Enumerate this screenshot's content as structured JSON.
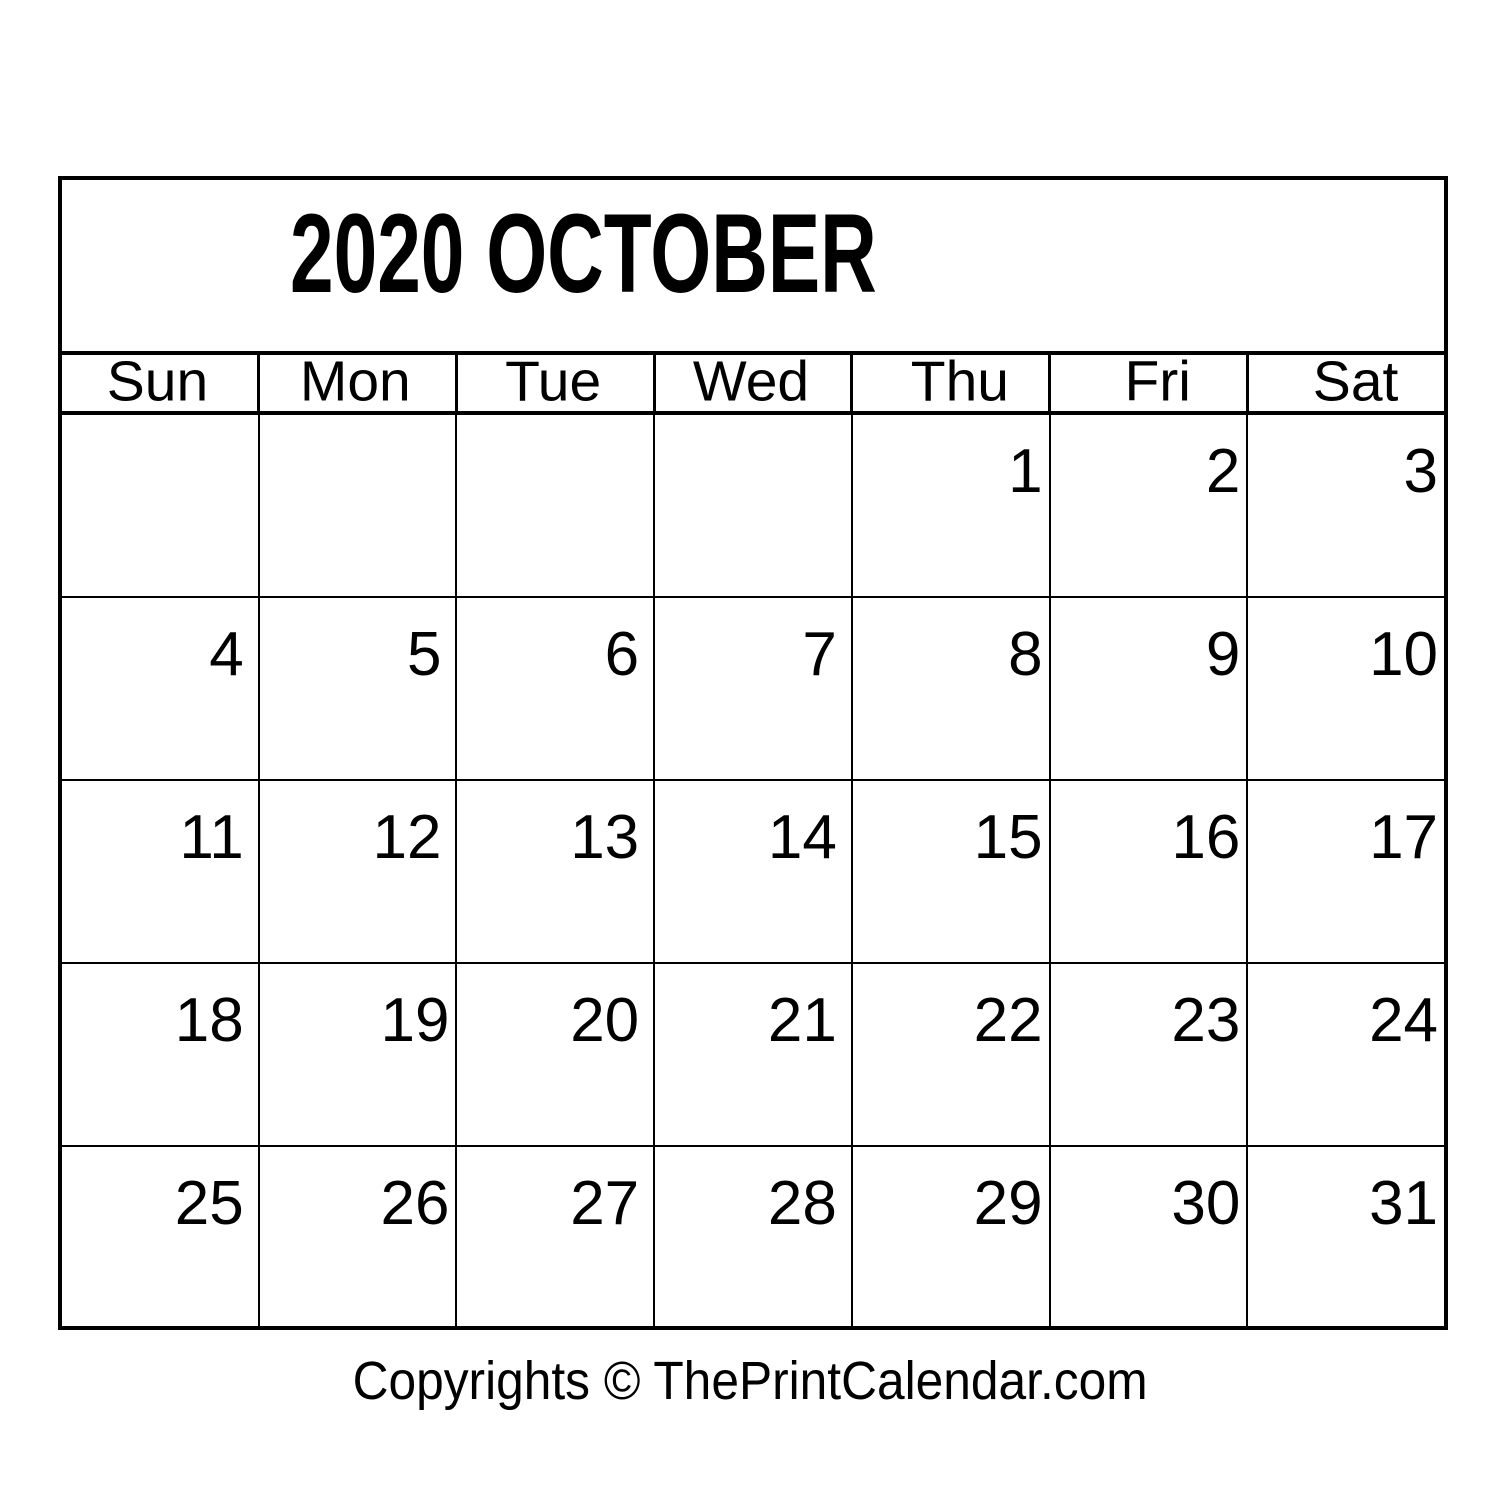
{
  "document": {
    "type": "printable-monthly-calendar",
    "background_color": "#ffffff",
    "text_color": "#000000",
    "border_color": "#000000"
  },
  "header": {
    "title": "2020  OCTOBER",
    "year": "2020",
    "month": "OCTOBER"
  },
  "weekdays": [
    {
      "label": "Sun"
    },
    {
      "label": "Mon"
    },
    {
      "label": "Tue"
    },
    {
      "label": "Wed"
    },
    {
      "label": "Thu"
    },
    {
      "label": "Fri"
    },
    {
      "label": "Sat"
    }
  ],
  "weeks": [
    {
      "days": [
        {
          "date": ""
        },
        {
          "date": ""
        },
        {
          "date": ""
        },
        {
          "date": ""
        },
        {
          "date": "1"
        },
        {
          "date": "2"
        },
        {
          "date": "3"
        }
      ]
    },
    {
      "days": [
        {
          "date": "4"
        },
        {
          "date": "5"
        },
        {
          "date": "6"
        },
        {
          "date": "7"
        },
        {
          "date": "8"
        },
        {
          "date": "9"
        },
        {
          "date": "10"
        }
      ]
    },
    {
      "days": [
        {
          "date": "11"
        },
        {
          "date": "12"
        },
        {
          "date": "13"
        },
        {
          "date": "14"
        },
        {
          "date": "15"
        },
        {
          "date": "16"
        },
        {
          "date": "17"
        }
      ]
    },
    {
      "days": [
        {
          "date": "18"
        },
        {
          "date": "19"
        },
        {
          "date": "20"
        },
        {
          "date": "21"
        },
        {
          "date": "22"
        },
        {
          "date": "23"
        },
        {
          "date": "24"
        }
      ]
    },
    {
      "days": [
        {
          "date": "25"
        },
        {
          "date": "26"
        },
        {
          "date": "27"
        },
        {
          "date": "28"
        },
        {
          "date": "29"
        },
        {
          "date": "30"
        },
        {
          "date": "31"
        }
      ]
    }
  ],
  "footer": {
    "copyright": "Copyrights © ThePrintCalendar.com"
  }
}
